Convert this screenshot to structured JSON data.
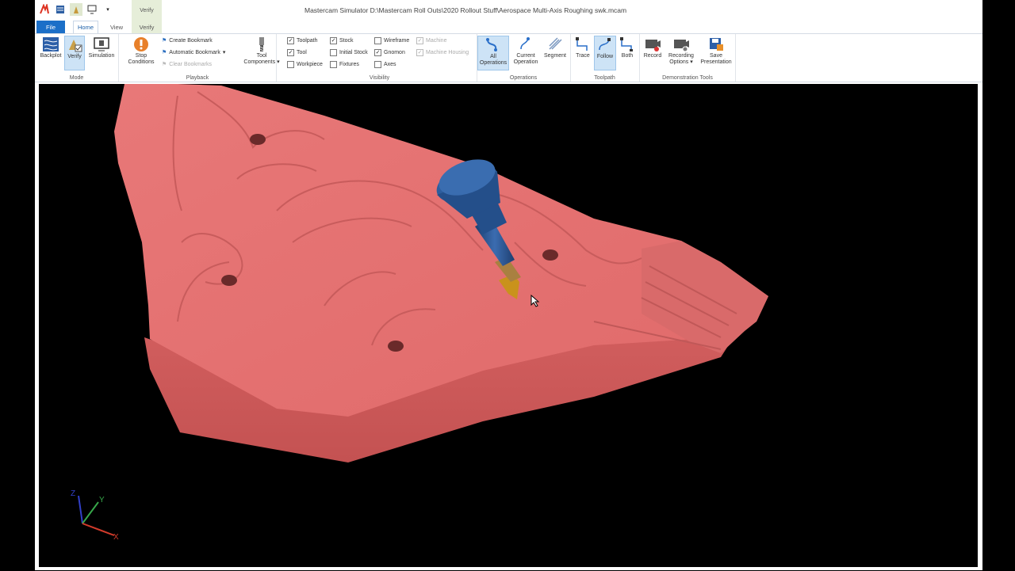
{
  "window": {
    "title": "Mastercam Simulator  D:\\Mastercam Roll Outs\\2020 Rollout Stuff\\Aerospace Multi-Axis Roughing swk.mcam",
    "context_tab_header": "Verify"
  },
  "tabs": {
    "file": "File",
    "home": "Home",
    "view": "View",
    "verify": "Verify"
  },
  "ribbon": {
    "mode": {
      "label": "Mode",
      "backplot": "Backplot",
      "verify": "Verify",
      "simulation": "Simulation"
    },
    "playback": {
      "label": "Playback",
      "stop_conditions": "Stop\nConditions",
      "create_bookmark": "Create Bookmark",
      "automatic_bookmark": "Automatic Bookmark",
      "clear_bookmarks": "Clear Bookmarks"
    },
    "tool_components": "Tool\nComponents",
    "visibility": {
      "label": "Visibility",
      "toolpath": "Toolpath",
      "tool": "Tool",
      "workpiece": "Workpiece",
      "stock": "Stock",
      "initial_stock": "Initial Stock",
      "fixtures": "Fixtures",
      "wireframe": "Wireframe",
      "gnomon": "Gnomon",
      "axes": "Axes",
      "machine": "Machine",
      "machine_housing": "Machine Housing"
    },
    "operations": {
      "label": "Operations",
      "all": "All\nOperations",
      "current": "Current\nOperation",
      "segment": "Segment"
    },
    "toolpath": {
      "label": "Toolpath",
      "trace": "Trace",
      "follow": "Follow",
      "both": "Both"
    },
    "demo": {
      "label": "Demonstration Tools",
      "record": "Record",
      "recording_options": "Recording\nOptions",
      "save_presentation": "Save\nPresentation"
    }
  },
  "colors": {
    "accent": "#1b6fc8",
    "part": "#e57373",
    "tool": "#2b5a9a",
    "background": "#000000"
  }
}
